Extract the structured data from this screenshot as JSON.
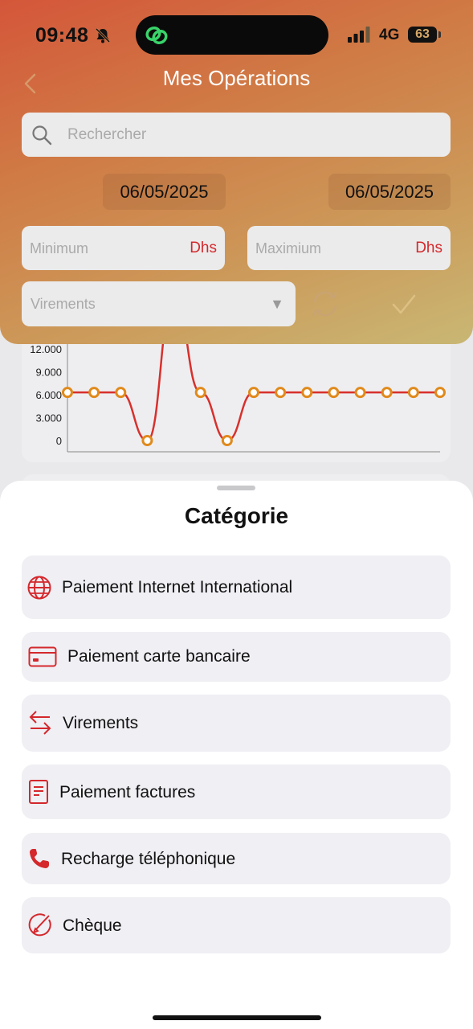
{
  "status_bar": {
    "time": "09:48",
    "network": "4G",
    "battery": "63"
  },
  "header": {
    "title": "Mes Opérations"
  },
  "filters": {
    "search_placeholder": "Rechercher",
    "date_from": "06/05/2025",
    "date_to": "06/05/2025",
    "min_placeholder": "Minimum",
    "max_placeholder": "Maximium",
    "currency": "Dhs",
    "category_selected": "Virements",
    "dropdown_arrow": "▼"
  },
  "chart_data": {
    "type": "line",
    "y_ticks": [
      "12.000",
      "9.000",
      "6.000",
      "3.000",
      "0"
    ],
    "ylim": [
      0,
      13500
    ],
    "series": [
      {
        "values": [
          6300,
          6300,
          6300,
          0,
          19000,
          6300,
          0,
          6300,
          6300,
          6300,
          6300,
          6300,
          6300,
          6300,
          6300
        ]
      }
    ],
    "colors": {
      "line": "#d8302c",
      "marker": "#e08a1c"
    }
  },
  "sheet": {
    "title": "Catégorie",
    "items": [
      {
        "label": "Paiement Internet International",
        "icon": "globe-icon"
      },
      {
        "label": "Paiement carte bancaire",
        "icon": "card-icon"
      },
      {
        "label": "Virements",
        "icon": "transfer-icon"
      },
      {
        "label": "Paiement factures",
        "icon": "bill-icon"
      },
      {
        "label": "Recharge téléphonique",
        "icon": "phone-icon"
      },
      {
        "label": "Chèque",
        "icon": "cheque-icon"
      }
    ]
  },
  "colors": {
    "accent_red": "#d4282c"
  }
}
